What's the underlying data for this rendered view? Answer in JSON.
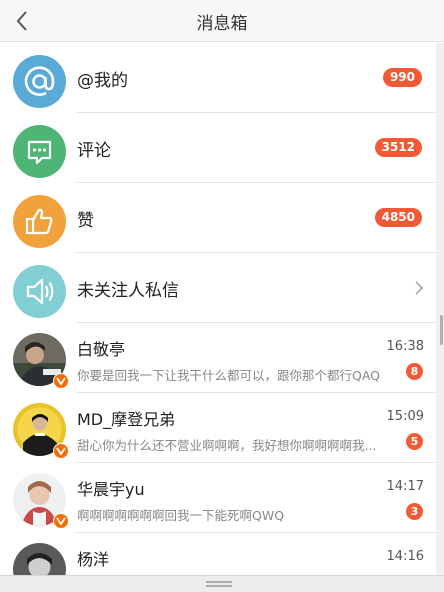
{
  "header": {
    "title": "消息箱"
  },
  "categories": [
    {
      "label": "@我的",
      "badge": "990",
      "icon": "at-icon",
      "color": "#5aaad8"
    },
    {
      "label": "评论",
      "badge": "3512",
      "icon": "comment-icon",
      "color": "#4fb574"
    },
    {
      "label": "赞",
      "badge": "4850",
      "icon": "thumbs-up-icon",
      "color": "#f2a23c"
    },
    {
      "label": "未关注人私信",
      "icon": "speaker-icon",
      "color": "#82cfd3"
    }
  ],
  "messages": [
    {
      "name": "白敬亭",
      "time": "16:38",
      "preview": "你要是回我一下让我干什么都可以，跟你那个都行QAQ",
      "count": "8",
      "verified": true
    },
    {
      "name": "MD_摩登兄弟",
      "time": "15:09",
      "preview": "甜心你为什么还不营业啊啊啊，我好想你啊啊啊啊我...",
      "count": "5",
      "verified": true
    },
    {
      "name": "华晨宇yu",
      "time": "14:17",
      "preview": "啊啊啊啊啊啊啊回我一下能死啊QWQ",
      "count": "3",
      "verified": true
    },
    {
      "name": "杨洋",
      "time": "14:16",
      "preview": "",
      "count": "",
      "verified": false
    }
  ],
  "colors": {
    "badge": "#f25a36",
    "verified": "#f26f00"
  }
}
